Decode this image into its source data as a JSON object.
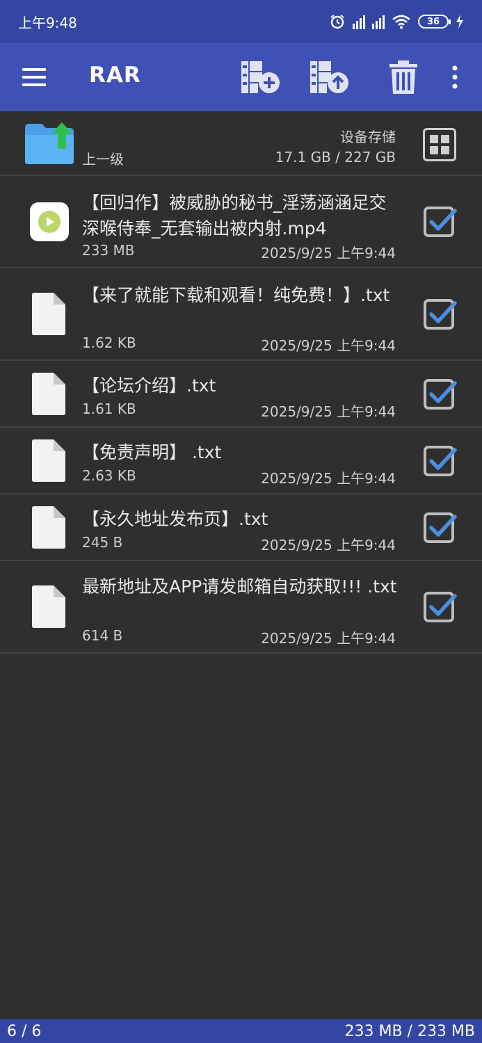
{
  "status": {
    "time": "上午9:48",
    "battery": "36"
  },
  "toolbar": {
    "title": "RAR"
  },
  "header": {
    "up_label": "上一级",
    "storage_name": "设备存储",
    "storage_size": "17.1 GB / 227 GB"
  },
  "files": [
    {
      "name": "【回归作】被威胁的秘书_淫荡涵涵足交深喉侍奉_无套输出被内射.mp4",
      "size": "233 MB",
      "date": "2025/9/25 上午9:44",
      "type": "video",
      "checked": true
    },
    {
      "name": "【来了就能下载和观看！纯免费！】.txt",
      "size": "1.62 KB",
      "date": "2025/9/25 上午9:44",
      "type": "text",
      "checked": true
    },
    {
      "name": "【论坛介绍】.txt",
      "size": "1.61 KB",
      "date": "2025/9/25 上午9:44",
      "type": "text",
      "checked": true
    },
    {
      "name": "【免责声明】 .txt",
      "size": "2.63 KB",
      "date": "2025/9/25 上午9:44",
      "type": "text",
      "checked": true
    },
    {
      "name": "【永久地址发布页】.txt",
      "size": "245 B",
      "date": "2025/9/25 上午9:44",
      "type": "text",
      "checked": true
    },
    {
      "name": "最新地址及APP请发邮箱自动获取!!! .txt",
      "size": "614 B",
      "date": "2025/9/25 上午9:44",
      "type": "text",
      "checked": true
    }
  ],
  "footer": {
    "count": "6 / 6",
    "total": "233 MB / 233 MB"
  },
  "colors": {
    "statusbar": "#3346a3",
    "toolbar": "#3f51b5",
    "background": "#2f2f2f",
    "check_accent": "#4a8fe0"
  }
}
